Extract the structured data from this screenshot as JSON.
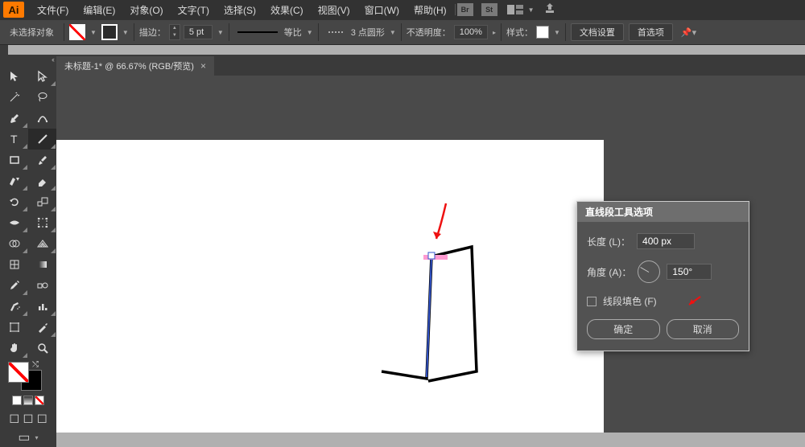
{
  "app_logo": "Ai",
  "menu": {
    "file": "文件(F)",
    "edit": "编辑(E)",
    "object": "对象(O)",
    "type": "文字(T)",
    "select": "选择(S)",
    "effect": "效果(C)",
    "view": "视图(V)",
    "window": "窗口(W)",
    "help": "帮助(H)"
  },
  "badges": {
    "br": "Br",
    "st": "St"
  },
  "options": {
    "no_selection": "未选择对象",
    "stroke_label": "描边：",
    "stroke_value": "5 pt",
    "uniform": "等比",
    "brush_profile": "3 点圆形",
    "opacity_label": "不透明度：",
    "opacity_value": "100%",
    "style_label": "样式：",
    "doc_setup": "文档设置",
    "prefs": "首选项"
  },
  "tab": {
    "title": "未标题-1* @ 66.67% (RGB/预览)"
  },
  "dialog": {
    "title": "直线段工具选项",
    "length_label": "长度 (L)：",
    "length_value": "400 px",
    "angle_label": "角度 (A)：",
    "angle_value": "150°",
    "fill_line_label": "线段填色 (F)",
    "ok": "确定",
    "cancel": "取消"
  },
  "chart_data": null
}
